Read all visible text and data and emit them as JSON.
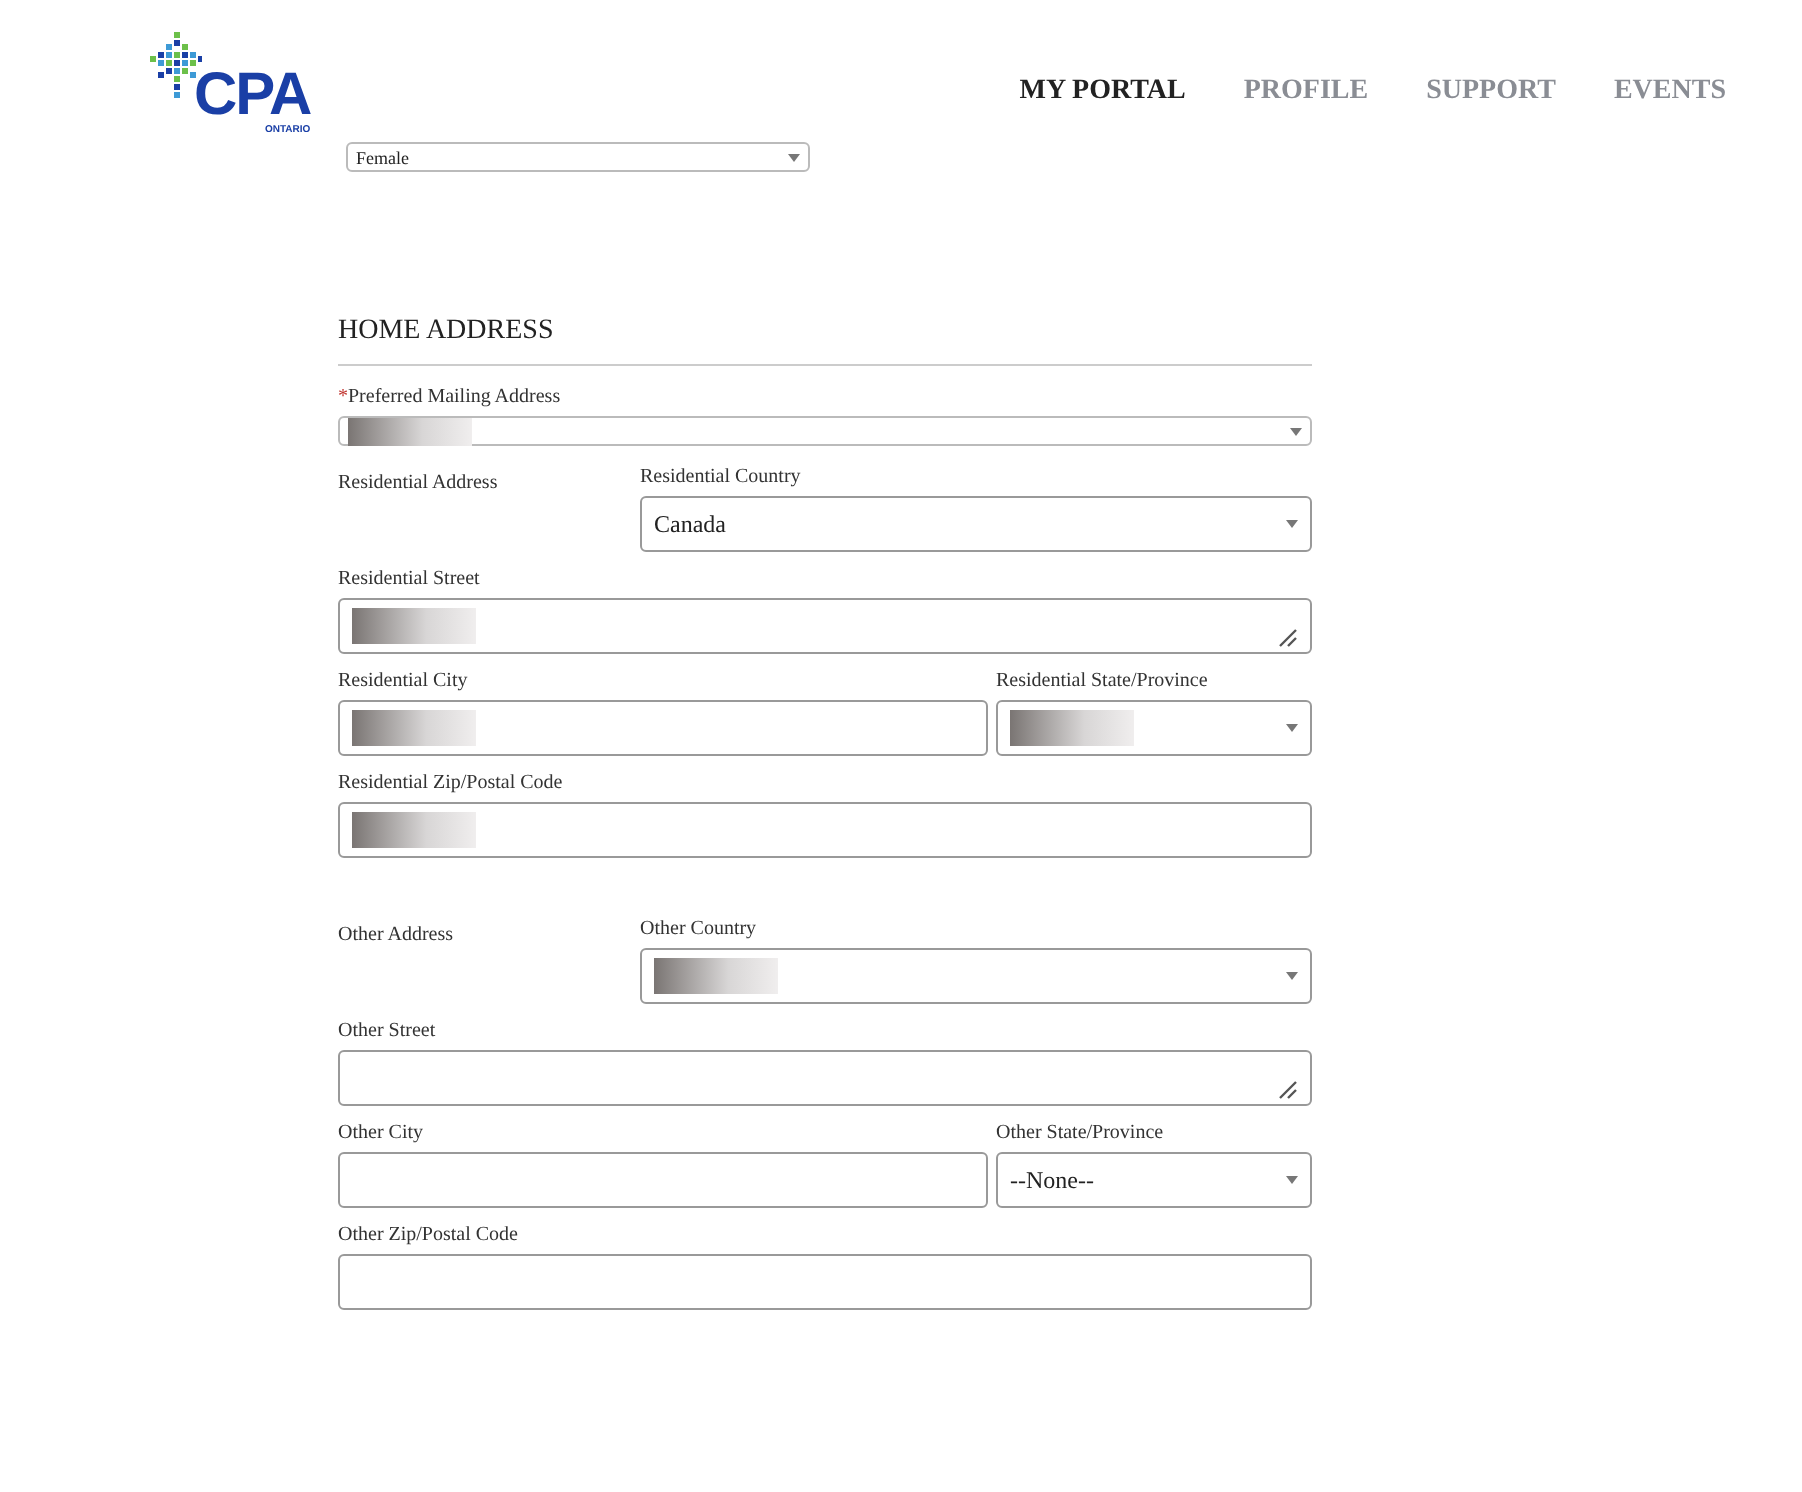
{
  "header": {
    "logo": {
      "name": "CPA",
      "subtitle": "ONTARIO"
    },
    "nav": [
      {
        "label": "MY PORTAL",
        "selected": true
      },
      {
        "label": "PROFILE",
        "selected": false
      },
      {
        "label": "SUPPORT",
        "selected": false
      },
      {
        "label": "EVENTS",
        "selected": false
      }
    ]
  },
  "gender_select": {
    "value": "Female"
  },
  "section": {
    "title": "HOME ADDRESS",
    "preferred_mailing": {
      "required_mark": "*",
      "label": "Preferred Mailing Address",
      "redacted": true
    },
    "groups": [
      {
        "title": "Residential Address",
        "country": {
          "kind": "select",
          "label": "Residential Country",
          "value": "Canada",
          "redacted": false
        },
        "rows": [
          [
            {
              "kind": "textarea",
              "label": "Residential Street",
              "redacted": true
            }
          ],
          [
            {
              "kind": "input",
              "label": "Residential City",
              "redacted": true
            },
            {
              "kind": "select",
              "label": "Residential State/Province",
              "redacted": true
            }
          ],
          [
            {
              "kind": "input",
              "label": "Residential Zip/Postal Code",
              "redacted": true
            }
          ]
        ]
      },
      {
        "title": "Other Address",
        "country": {
          "kind": "select",
          "label": "Other Country",
          "redacted": true
        },
        "rows": [
          [
            {
              "kind": "textarea",
              "label": "Other Street",
              "redacted": false
            }
          ],
          [
            {
              "kind": "input",
              "label": "Other City",
              "redacted": false
            },
            {
              "kind": "select",
              "label": "Other State/Province",
              "value": "--None--",
              "redacted": false
            }
          ],
          [
            {
              "kind": "input",
              "label": "Other Zip/Postal Code",
              "redacted": false
            }
          ]
        ]
      }
    ]
  }
}
